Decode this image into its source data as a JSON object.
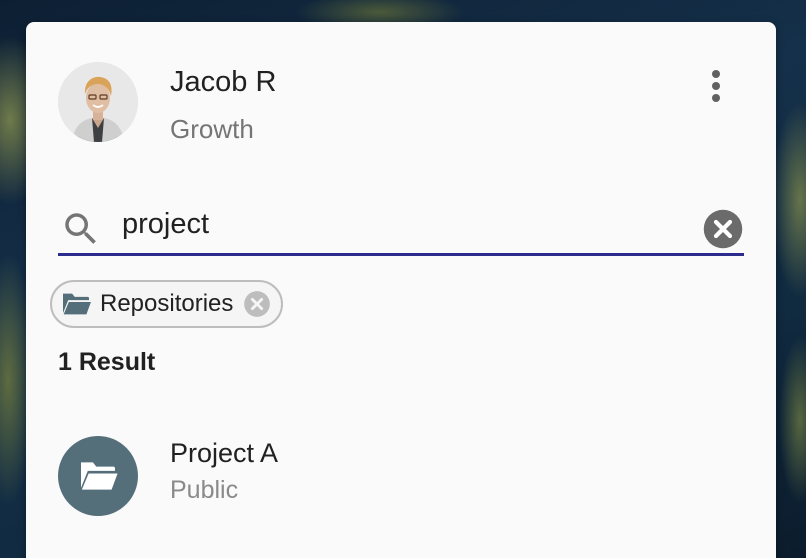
{
  "profile": {
    "name": "Jacob R",
    "role": "Growth",
    "avatar_icon": "user-photo"
  },
  "menu": {
    "icon": "more-vert-icon"
  },
  "search": {
    "value": "project",
    "placeholder": "",
    "icon": "search-icon",
    "clear_icon": "close-circle-icon",
    "underline_color": "#2c2c8c"
  },
  "filter_chip": {
    "label": "Repositories",
    "icon": "folder-open-icon",
    "remove_icon": "close-circle-icon"
  },
  "results": {
    "count_label": "1 Result",
    "items": [
      {
        "title": "Project A",
        "subtitle": "Public",
        "icon": "folder-open-icon",
        "icon_bg": "#546e7a"
      }
    ]
  }
}
